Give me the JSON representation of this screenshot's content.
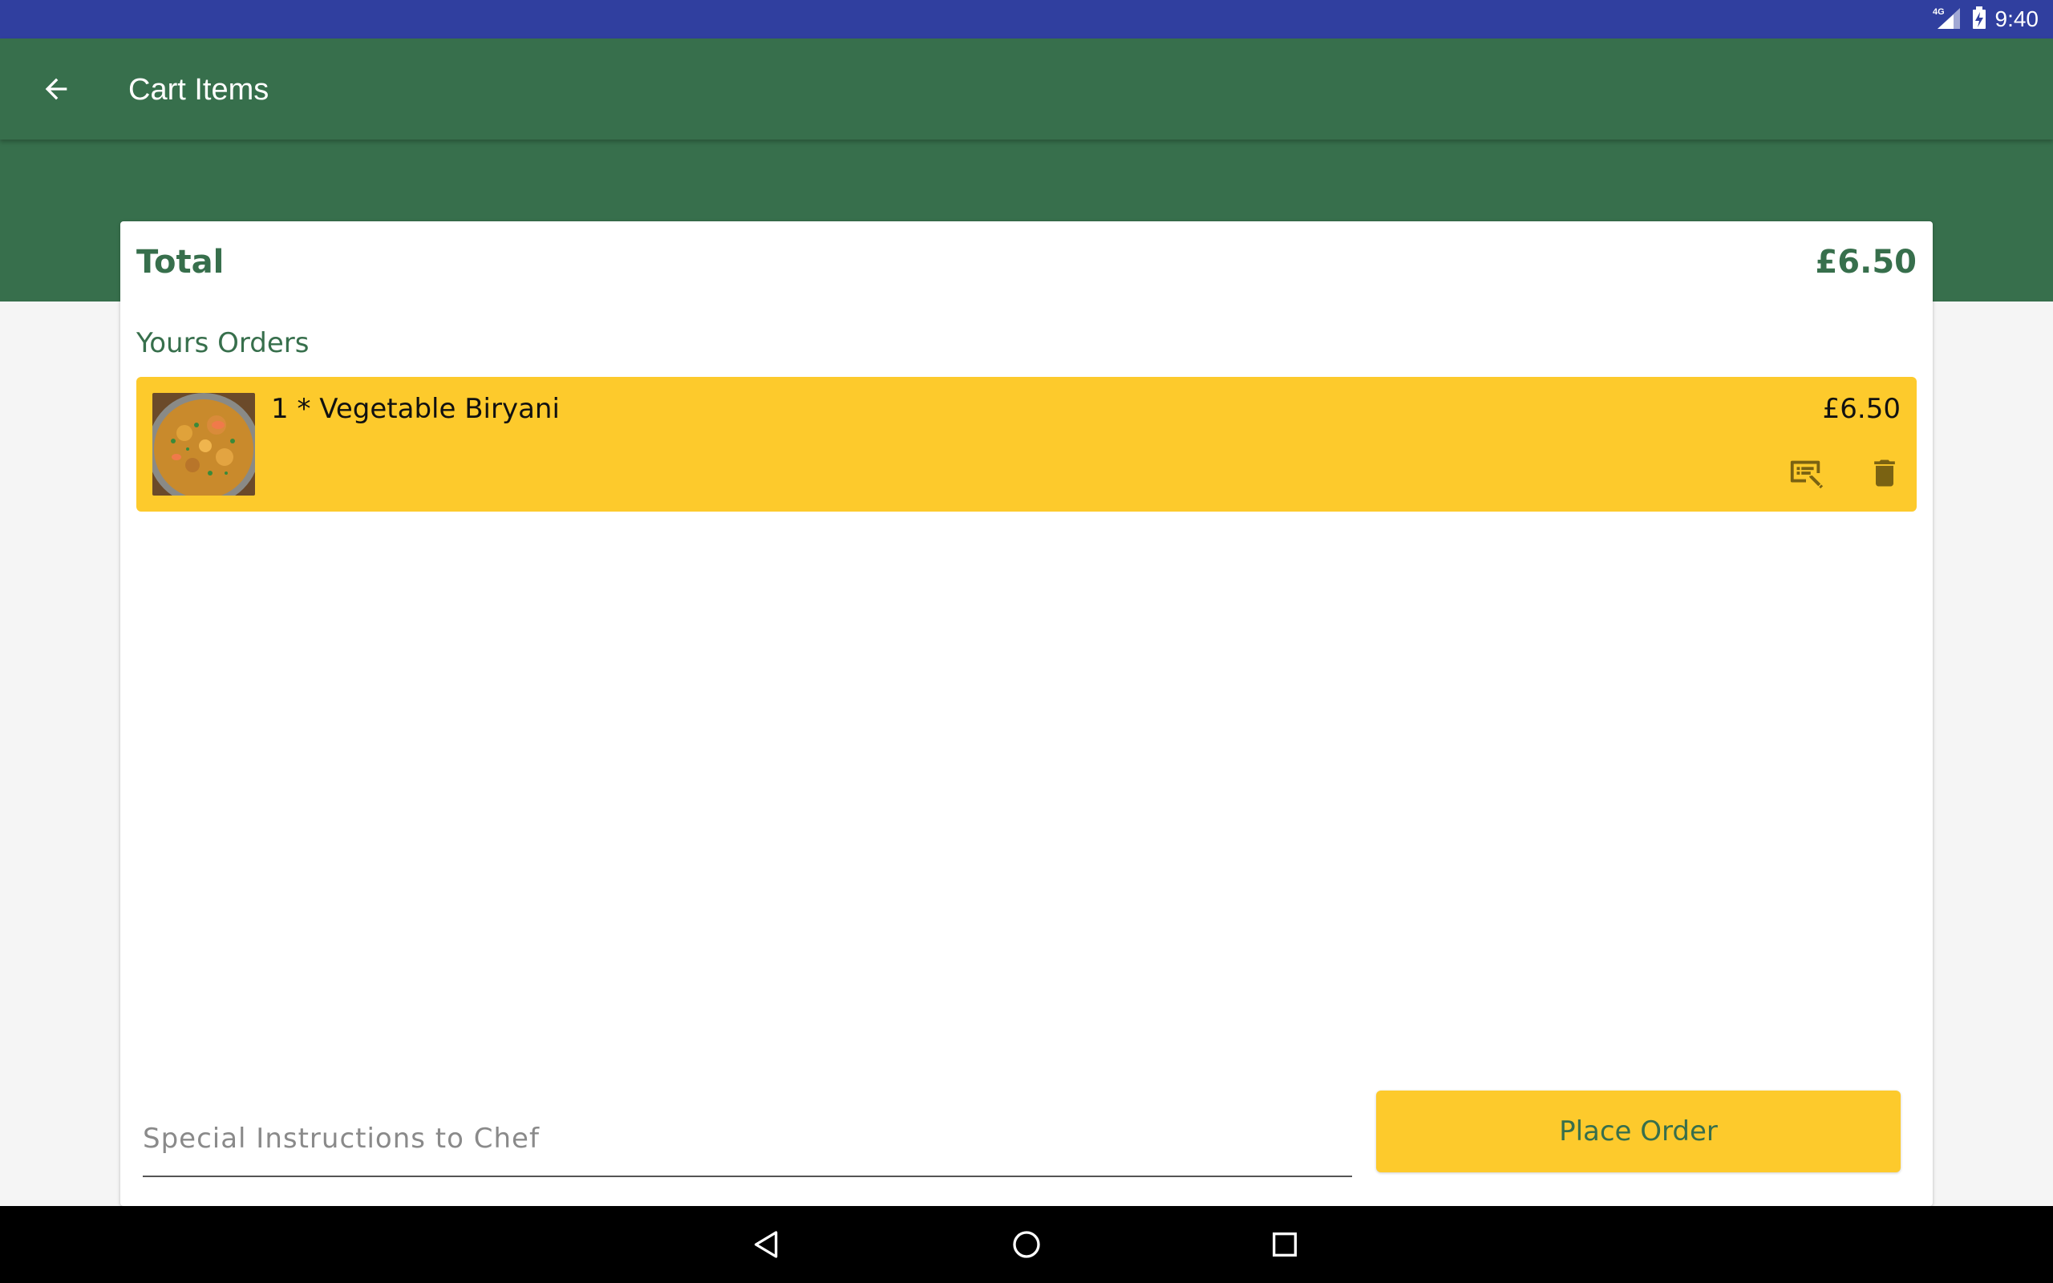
{
  "status_bar": {
    "network": "4G",
    "time": "9:40"
  },
  "app_bar": {
    "title": "Cart Items",
    "back_icon": "arrow-back-icon"
  },
  "summary": {
    "total_label": "Total",
    "total_value": "£6.50"
  },
  "orders": {
    "section_title": "Yours Orders",
    "items": [
      {
        "name": "1 * Vegetable Biryani",
        "price": "£6.50",
        "image_icon": "biryani-dish-image",
        "actions": [
          "special-instructions-icon",
          "delete-icon"
        ]
      }
    ]
  },
  "instructions": {
    "placeholder": "Special Instructions to Chef",
    "value": ""
  },
  "actions": {
    "place_order_label": "Place Order"
  },
  "colors": {
    "status_bar": "#303f9f",
    "primary": "#376f4c",
    "accent": "#fdca2c",
    "icon_dark": "#7a6212",
    "background": "#f5f5f5"
  }
}
